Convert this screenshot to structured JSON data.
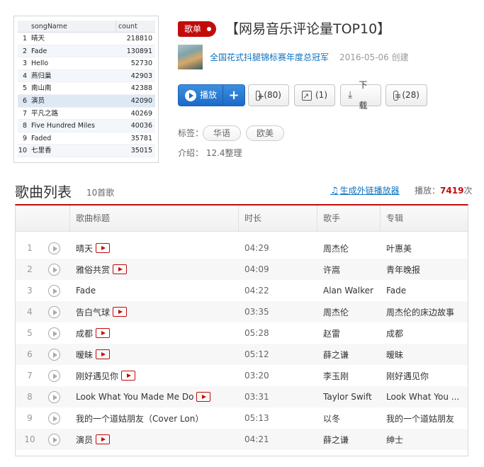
{
  "cover_sheet": {
    "headers": [
      "songName",
      "count"
    ],
    "rows": [
      {
        "n": "1",
        "name": "晴天",
        "count": "218810"
      },
      {
        "n": "2",
        "name": "Fade",
        "count": "130891"
      },
      {
        "n": "3",
        "name": "Hello",
        "count": "52730"
      },
      {
        "n": "4",
        "name": "燕归巢",
        "count": "42903"
      },
      {
        "n": "5",
        "name": "南山南",
        "count": "42388"
      },
      {
        "n": "6",
        "name": "演员",
        "count": "42090"
      },
      {
        "n": "7",
        "name": "平凡之路",
        "count": "40269"
      },
      {
        "n": "8",
        "name": "Five Hundred Miles",
        "count": "40036"
      },
      {
        "n": "9",
        "name": "Faded",
        "count": "35781"
      },
      {
        "n": "10",
        "name": "七里香",
        "count": "35015"
      }
    ]
  },
  "playlist": {
    "badge": "歌单",
    "title": "【网易音乐评论量TOP10】",
    "creator": "全国花式抖腿锦标赛年度总冠军",
    "created": "2016-05-06 创建",
    "play_label": "播放",
    "plus_label": "+",
    "collect_label": "(80)",
    "share_label": "(1)",
    "download_label": "下载",
    "comment_label": "(28)",
    "tags_label": "标签：",
    "tags": [
      "华语",
      "欧美"
    ],
    "intro": "介绍：  12.4整理"
  },
  "song_list": {
    "title": "歌曲列表",
    "count": "10首歌",
    "ext_link": "生成外链播放器",
    "play_prefix": "播放：",
    "play_count": "7419",
    "play_suffix": "次",
    "columns": [
      "歌曲标题",
      "时长",
      "歌手",
      "专辑"
    ],
    "songs": [
      {
        "idx": "1",
        "name": "晴天",
        "mv": true,
        "dur": "04:29",
        "artist": "周杰伦",
        "album": "叶惠美"
      },
      {
        "idx": "2",
        "name": "雅俗共赏",
        "mv": true,
        "dur": "04:09",
        "artist": "许嵩",
        "album": "青年晚报"
      },
      {
        "idx": "3",
        "name": "Fade",
        "mv": false,
        "dur": "04:22",
        "artist": "Alan Walker",
        "album": "Fade"
      },
      {
        "idx": "4",
        "name": "告白气球",
        "mv": true,
        "dur": "03:35",
        "artist": "周杰伦",
        "album": "周杰伦的床边故事"
      },
      {
        "idx": "5",
        "name": "成都",
        "mv": true,
        "dur": "05:28",
        "artist": "赵雷",
        "album": "成都"
      },
      {
        "idx": "6",
        "name": "暧昧",
        "mv": true,
        "dur": "05:12",
        "artist": "薛之谦",
        "album": "暧昧"
      },
      {
        "idx": "7",
        "name": "刚好遇见你",
        "mv": true,
        "dur": "03:20",
        "artist": "李玉刚",
        "album": "刚好遇见你"
      },
      {
        "idx": "8",
        "name": "Look What You Made Me Do",
        "mv": true,
        "dur": "03:31",
        "artist": "Taylor Swift",
        "album": "Look What You ..."
      },
      {
        "idx": "9",
        "name": "我的一个道姑朋友（Cover Lon）",
        "mv": false,
        "dur": "05:13",
        "artist": "以冬",
        "album": "我的一个道姑朋友"
      },
      {
        "idx": "10",
        "name": "演员",
        "mv": true,
        "dur": "04:21",
        "artist": "薛之谦",
        "album": "绅士"
      }
    ]
  }
}
